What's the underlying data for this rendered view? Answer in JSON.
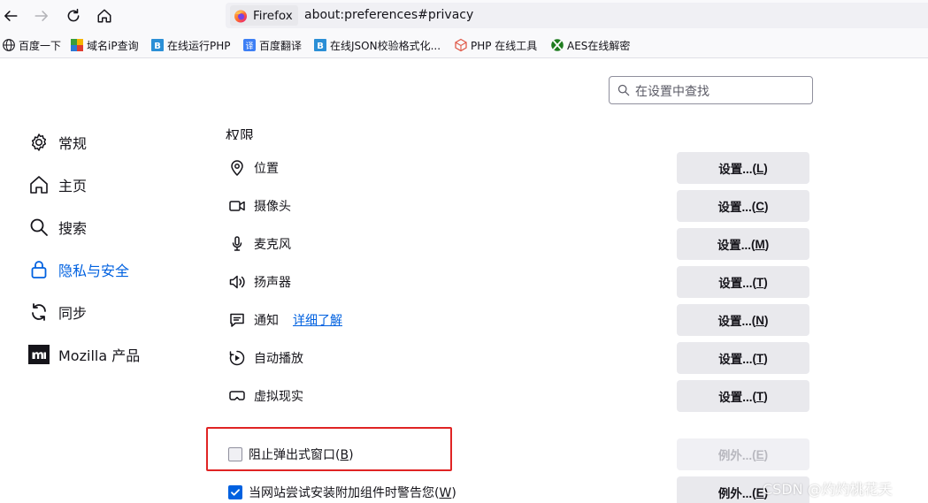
{
  "browser": {
    "identity_label": "Firefox",
    "url": "about:preferences#privacy"
  },
  "bookmarks": [
    {
      "label": "百度一下",
      "icon": "globe-icon"
    },
    {
      "label": "域名iP查询",
      "icon": "puzzle-icon"
    },
    {
      "label": "在线运行PHP",
      "icon": "bejson-icon"
    },
    {
      "label": "百度翻译",
      "icon": "translate-icon"
    },
    {
      "label": "在线JSON校验格式化...",
      "icon": "bejson-icon"
    },
    {
      "label": "PHP 在线工具",
      "icon": "cube-icon"
    },
    {
      "label": "AES在线解密",
      "icon": "xbox-icon"
    }
  ],
  "search": {
    "placeholder": "在设置中查找"
  },
  "sidebar": {
    "items": [
      {
        "label": "常规",
        "icon": "gear-icon"
      },
      {
        "label": "主页",
        "icon": "home-icon"
      },
      {
        "label": "搜索",
        "icon": "search-icon"
      },
      {
        "label": "隐私与安全",
        "icon": "lock-icon",
        "selected": true
      },
      {
        "label": "同步",
        "icon": "sync-icon"
      },
      {
        "label": "Mozilla 产品",
        "icon": "mozilla-icon"
      }
    ]
  },
  "permissions": {
    "title": "权限",
    "learn_more": "详细了解",
    "rows": [
      {
        "label": "位置",
        "icon": "location-icon",
        "button": "设置...",
        "key": "L"
      },
      {
        "label": "摄像头",
        "icon": "camera-icon",
        "button": "设置...",
        "key": "C"
      },
      {
        "label": "麦克风",
        "icon": "microphone-icon",
        "button": "设置...",
        "key": "M"
      },
      {
        "label": "扬声器",
        "icon": "speaker-icon",
        "button": "设置...",
        "key": "T"
      },
      {
        "label": "通知",
        "icon": "notification-icon",
        "button": "设置...",
        "key": "N"
      },
      {
        "label": "自动播放",
        "icon": "autoplay-icon",
        "button": "设置...",
        "key": "T"
      },
      {
        "label": "虚拟现实",
        "icon": "vr-icon",
        "button": "设置...",
        "key": "T"
      }
    ],
    "checkboxes": [
      {
        "label_prefix": "阻止弹出式窗口(",
        "key": "B",
        "label_suffix": ")",
        "checked": false,
        "button": "例外...",
        "button_key": "E",
        "button_disabled": true
      },
      {
        "label_prefix": "当网站尝试安装附加组件时警告您(",
        "key": "W",
        "label_suffix": ")",
        "checked": true,
        "button": "例外...",
        "button_key": "E",
        "button_disabled": false
      }
    ]
  },
  "watermark": "CSDN @灼灼桃花夭",
  "colors": {
    "accent": "#0061e0",
    "highlight": "#e02424",
    "button_bg": "#e9e9ed"
  }
}
